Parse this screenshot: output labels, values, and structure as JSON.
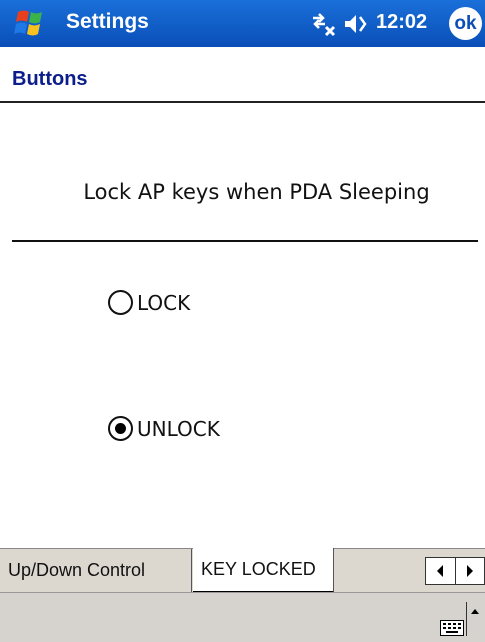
{
  "titlebar": {
    "title": "Settings",
    "clock": "12:02",
    "ok_label": "ok",
    "icons": [
      "windows-start-icon",
      "connectivity-icon",
      "volume-icon"
    ]
  },
  "page": {
    "title": "Buttons",
    "prompt": "Lock AP keys when PDA Sleeping"
  },
  "options": {
    "lock": {
      "label": "LOCK",
      "selected": false
    },
    "unlock": {
      "label": "UNLOCK",
      "selected": true
    }
  },
  "tabs": {
    "items": [
      {
        "label": "Up/Down Control",
        "active": false
      },
      {
        "label": "KEY LOCKED",
        "active": true
      }
    ]
  },
  "colors": {
    "titlebar": "#0b5ac8",
    "page_title": "#0c1d8c",
    "tabstrip": "#dcd8d0"
  }
}
